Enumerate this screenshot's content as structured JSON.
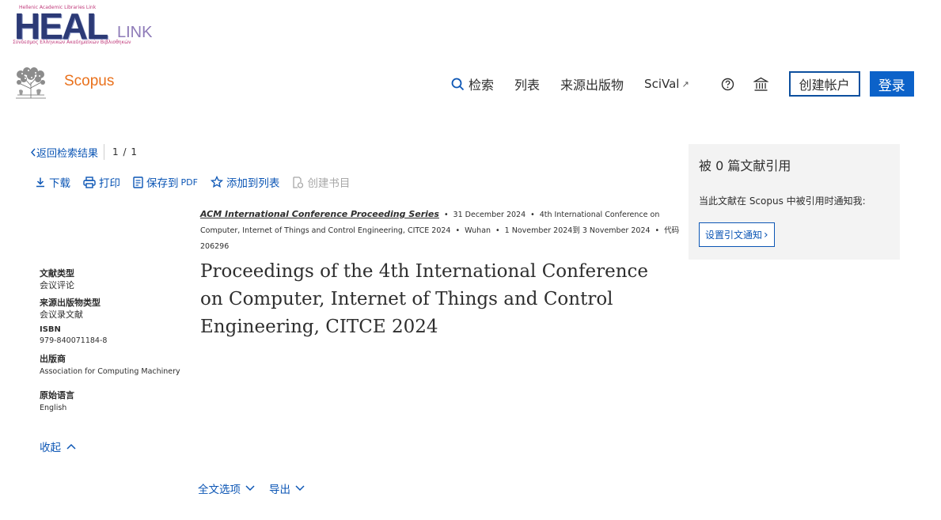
{
  "institution": {
    "top_text": "Hellenic Academic Libraries Link",
    "big_text": "HEAL",
    "link_text": "LINK",
    "sub_text": "Σύνδεσμος Ελληνικών Ακαδημαϊκών Βιβλιοθηκών"
  },
  "brand": {
    "name": "Scopus",
    "color": "#e9711c"
  },
  "nav": {
    "search": "检索",
    "lists": "列表",
    "sources": "来源出版物",
    "scival": "SciVal",
    "scival_icon": "↗",
    "help_icon": "help-circle-icon",
    "institution_icon": "institution-icon",
    "create_account": "创建帐户",
    "login": "登录"
  },
  "breadcrumb": {
    "back": "返回检索结果",
    "pager": "1 / 1"
  },
  "actions": {
    "download": "下载",
    "print": "打印",
    "save_pdf": "保存到",
    "save_pdf_suffix": "PDF",
    "add_list": "添加到列表",
    "create_bib": "创建书目"
  },
  "source": {
    "series": "ACM International Conference Proceeding Series",
    "date": "31 December 2024",
    "conference": "4th International Conference on Computer, Internet of Things and Control Engineering, CITCE 2024",
    "location": "Wuhan",
    "dates_range": "1 November 2024到 3 November 2024",
    "code": "代码 206296"
  },
  "document": {
    "title": "Proceedings of the 4th International Conference on Computer, Internet of Things and Control Engineering, CITCE 2024"
  },
  "metadata": {
    "doc_type_label": "文献类型",
    "doc_type_value": "会议评论",
    "source_type_label": "来源出版物类型",
    "source_type_value": "会议录文献",
    "isbn_label": "ISBN",
    "isbn_value": "979-840071184-8",
    "publisher_label": "出版商",
    "publisher_value": "Association for Computing Machinery",
    "language_label": "原始语言",
    "language_value": "English",
    "collapse": "收起"
  },
  "bottom": {
    "full_text": "全文选项",
    "export": "导出"
  },
  "citations": {
    "title": "被 0 篇文献引用",
    "notify_text": "当此文献在 Scopus 中被引用时通知我:",
    "button": "设置引文通知",
    "button_chevron": "›"
  },
  "colors": {
    "link": "#0c56b5",
    "primary": "#0c62c9",
    "panel_bg": "#f3f3f3"
  }
}
